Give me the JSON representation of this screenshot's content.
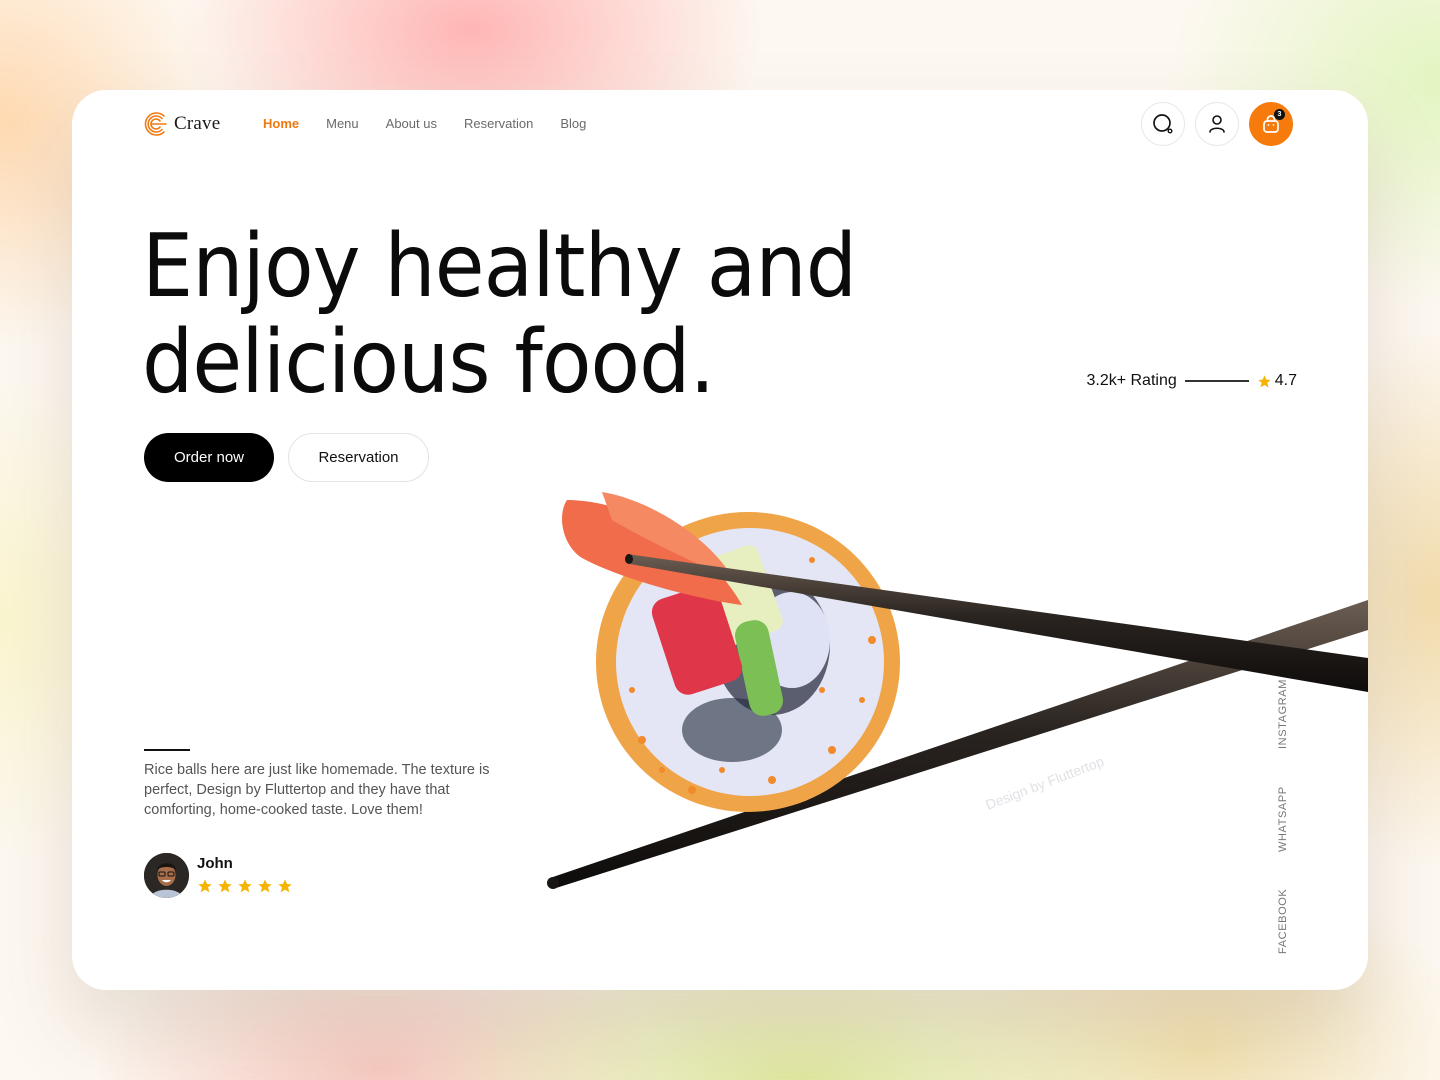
{
  "brand": {
    "name": "Crave",
    "accent": "#f67a0c"
  },
  "nav": {
    "items": [
      {
        "label": "Home",
        "active": true
      },
      {
        "label": "Menu",
        "active": false
      },
      {
        "label": "About us",
        "active": false
      },
      {
        "label": "Reservation",
        "active": false
      },
      {
        "label": "Blog",
        "active": false
      }
    ]
  },
  "actions": {
    "search_icon": "search-icon",
    "user_icon": "user-icon",
    "cart_icon": "shopping-bag-icon",
    "cart_count": "3"
  },
  "hero": {
    "headline_line1": "Enjoy healthy and",
    "headline_line2": "delicious food.",
    "order_label": "Order now",
    "reservation_label": "Reservation",
    "image_watermark": "Design by Fluttertop"
  },
  "rating": {
    "count_label": "3.2k+ Rating",
    "value": "4.7",
    "star_color": "#f5b400"
  },
  "review": {
    "text": "Rice balls here are just like homemade. The texture is perfect, Design by Fluttertop and they have that comforting, home-cooked taste. Love them!",
    "author": "John",
    "stars": 5
  },
  "socials": [
    "INSTAGRAM",
    "WHATSAPP",
    "FACEBOOK"
  ]
}
